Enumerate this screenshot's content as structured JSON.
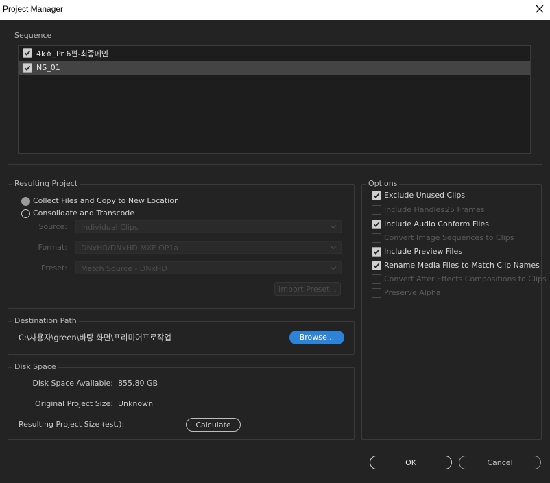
{
  "window": {
    "title": "Project Manager",
    "close_icon": "close-icon"
  },
  "sequence": {
    "group_title": "Sequence",
    "items": [
      {
        "label": "4k쇼_Pr 6편-최종메인",
        "checked": true,
        "selected": false
      },
      {
        "label": "NS_01",
        "checked": true,
        "selected": true
      }
    ]
  },
  "resulting_project": {
    "group_title": "Resulting Project",
    "collect_label": "Collect Files and Copy to New Location",
    "consolidate_label": "Consolidate and Transcode",
    "selected": "collect",
    "source_label": "Source:",
    "source_value": "Individual Clips",
    "format_label": "Format:",
    "format_value": "DNxHR/DNxHD MXF OP1a",
    "preset_label": "Preset:",
    "preset_value": "Match Source - DNxHD",
    "import_preset_label": "Import Preset..."
  },
  "options": {
    "group_title": "Options",
    "items": [
      {
        "label": "Exclude Unused Clips",
        "checked": true,
        "enabled": true
      },
      {
        "label": "Include Handles:",
        "value": "25 Frames",
        "checked": false,
        "enabled": false
      },
      {
        "label": "Include Audio Conform Files",
        "checked": true,
        "enabled": true
      },
      {
        "label": "Convert Image Sequences to Clips",
        "checked": false,
        "enabled": false
      },
      {
        "label": "Include Preview Files",
        "checked": true,
        "enabled": true
      },
      {
        "label": "Rename Media Files to Match Clip Names",
        "checked": true,
        "enabled": true
      },
      {
        "label": "Convert After Effects Compositions to Clips",
        "checked": false,
        "enabled": false
      },
      {
        "label": "Preserve Alpha",
        "checked": false,
        "enabled": false
      }
    ]
  },
  "destination": {
    "group_title": "Destination Path",
    "path": "C:\\사용자\\green\\바탕 화면\\프리미어프로작업",
    "browse_label": "Browse..."
  },
  "disk_space": {
    "group_title": "Disk Space",
    "available_label": "Disk Space Available:",
    "available_value": "855.80 GB",
    "original_label": "Original Project Size:",
    "original_value": "Unknown",
    "resulting_label": "Resulting Project Size (est.):",
    "calculate_label": "Calculate"
  },
  "footer": {
    "ok_label": "OK",
    "cancel_label": "Cancel"
  },
  "colors": {
    "accent": "#2d83d8",
    "background": "#232323"
  }
}
